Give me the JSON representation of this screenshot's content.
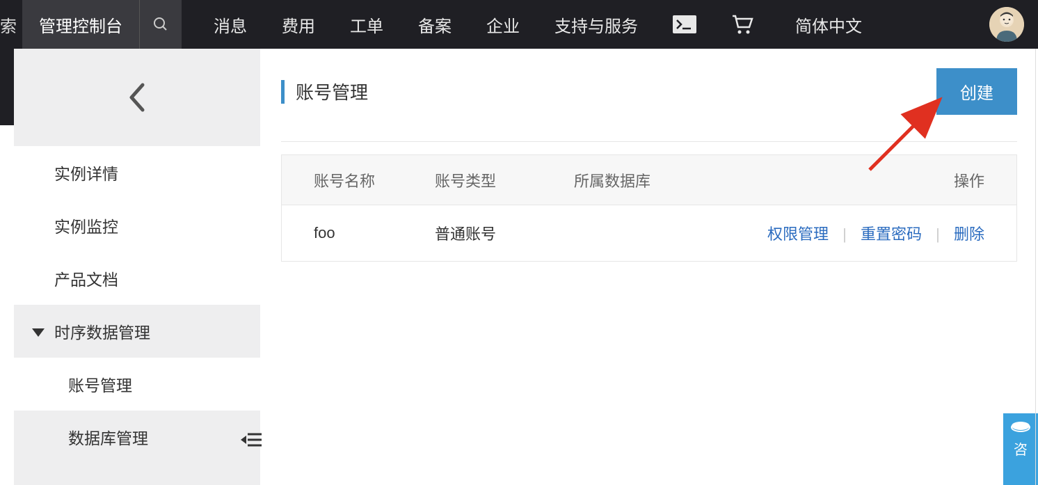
{
  "topbar": {
    "search_label": "索",
    "console_label": "管理控制台",
    "nav": {
      "messages": "消息",
      "billing": "费用",
      "tickets": "工单",
      "beian": "备案",
      "enterprise": "企业",
      "support": "支持与服务"
    },
    "lang": "简体中文"
  },
  "sidebar": {
    "items": {
      "instance_detail": "实例详情",
      "instance_monitor": "实例监控",
      "product_docs": "产品文档",
      "tsdata_group": "时序数据管理",
      "account_mgmt": "账号管理",
      "database_mgmt": "数据库管理"
    }
  },
  "content": {
    "title": "账号管理",
    "create_label": "创建",
    "columns": {
      "name": "账号名称",
      "type": "账号类型",
      "db": "所属数据库",
      "ops": "操作"
    },
    "rows": [
      {
        "name": "foo",
        "type": "普通账号",
        "db": "",
        "ops": {
          "perm": "权限管理",
          "reset": "重置密码",
          "delete": "删除"
        }
      }
    ]
  },
  "feedback": "咨"
}
